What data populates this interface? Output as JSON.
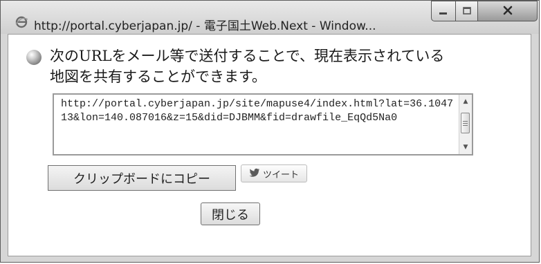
{
  "window": {
    "title": "http://portal.cyberjapan.jp/ - 電子国土Web.Next - Window...",
    "title_icon": "ie-icon",
    "buttons": {
      "minimize_icon": "minimize-icon",
      "maximize_icon": "maximize-icon",
      "close_icon": "close-icon"
    }
  },
  "dialog": {
    "message_line1": "次のURLをメール等で送付することで、現在表示されている",
    "message_line2": "地図を共有することができます。",
    "bullet_icon": "bullet-icon",
    "share_url": "http://portal.cyberjapan.jp/site/mapuse4/index.html?lat=36.104713&lon=140.087016&z=15&did=DJBMM&fid=drawfile_EqQd5Na0",
    "copy_button": "クリップボードにコピー",
    "tweet_button": "ツイート",
    "tweet_icon": "twitter-bird-icon",
    "close_button": "閉じる"
  },
  "colors": {
    "frame": "#d6d6d6",
    "client_bg": "#ffffff",
    "text": "#222222"
  }
}
